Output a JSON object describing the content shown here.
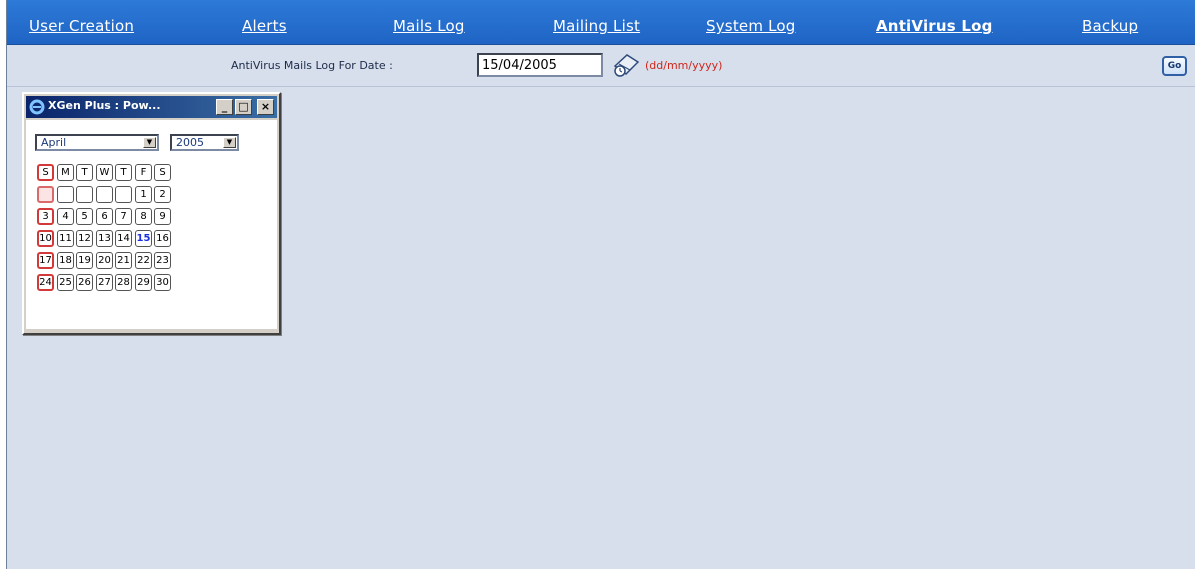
{
  "nav": {
    "items": [
      {
        "label": "User Creation",
        "active": false
      },
      {
        "label": "Alerts",
        "active": false
      },
      {
        "label": "Mails Log",
        "active": false
      },
      {
        "label": "Mailing List",
        "active": false
      },
      {
        "label": "System Log",
        "active": false
      },
      {
        "label": "AntiVirus Log",
        "active": true
      },
      {
        "label": "Backup",
        "active": false
      }
    ]
  },
  "filter": {
    "label": "AntiVirus Mails Log For Date :",
    "date_value": "15/04/2005",
    "date_format": "(dd/mm/yyyy)",
    "go_label": "Go",
    "calendar_icon": "calendar-icon"
  },
  "calendar_popup": {
    "title": "XGen Plus : Pow...",
    "title_icon": "internet-explorer-icon",
    "minimize_label": "_",
    "maximize_label": "□",
    "close_label": "×",
    "month": "April",
    "year": "2005",
    "weekdays": [
      "S",
      "M",
      "T",
      "W",
      "T",
      "F",
      "S"
    ],
    "weeks": [
      [
        "",
        "",
        "",
        "",
        "",
        "1",
        "2"
      ],
      [
        "3",
        "4",
        "5",
        "6",
        "7",
        "8",
        "9"
      ],
      [
        "10",
        "11",
        "12",
        "13",
        "14",
        "15",
        "16"
      ],
      [
        "17",
        "18",
        "19",
        "20",
        "21",
        "22",
        "23"
      ],
      [
        "24",
        "25",
        "26",
        "27",
        "28",
        "29",
        "30"
      ]
    ],
    "selected_day": "15"
  },
  "colors": {
    "nav_bg": "#2d7ad8",
    "page_bg": "#d8dfec",
    "format_hint": "#d0261a",
    "sunday_border": "#d23a3a",
    "selected_day": "#1a2fe0"
  }
}
